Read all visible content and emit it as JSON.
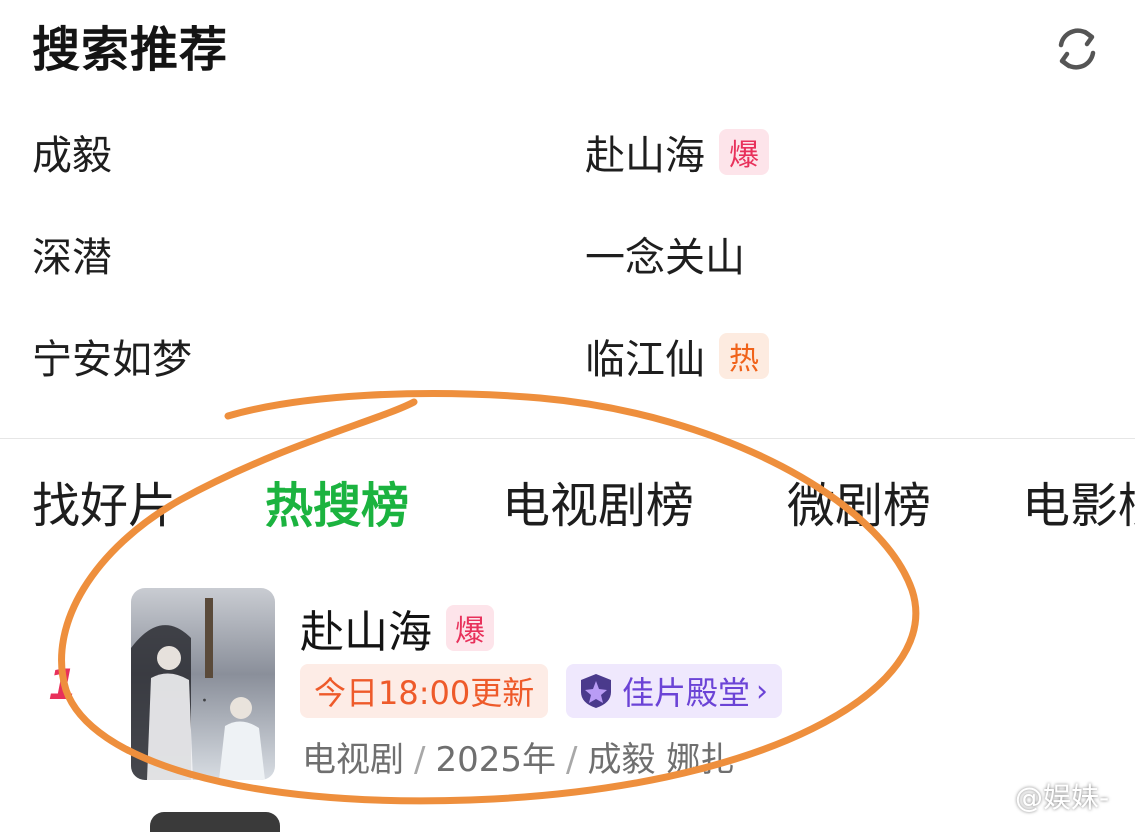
{
  "search_recommend": {
    "title": "搜索推荐",
    "refresh_icon": "refresh-icon",
    "items": [
      {
        "label": "成毅",
        "badge": ""
      },
      {
        "label": "赴山海",
        "badge": "爆"
      },
      {
        "label": "深潜",
        "badge": ""
      },
      {
        "label": "一念关山",
        "badge": ""
      },
      {
        "label": "宁安如梦",
        "badge": ""
      },
      {
        "label": "临江仙",
        "badge": "热"
      }
    ]
  },
  "tabs": [
    "找好片",
    "热搜榜",
    "电视剧榜",
    "微剧榜",
    "电影榜"
  ],
  "active_tab": "热搜榜",
  "ranking": {
    "rank": "1",
    "title": "赴山海",
    "title_badge": "爆",
    "update_tag": "今日18:00更新",
    "hall_tag": "佳片殿堂",
    "meta": {
      "type": "电视剧",
      "year": "2025年",
      "cast": "成毅 娜扎"
    }
  },
  "watermark": "@娱妹-",
  "colors": {
    "accent_green": "#1bb33f",
    "bao_badge": "#e8315b",
    "re_badge": "#f0631b",
    "hall_purple": "#6b43d6",
    "annotation_circle": "#ee8f3d"
  }
}
